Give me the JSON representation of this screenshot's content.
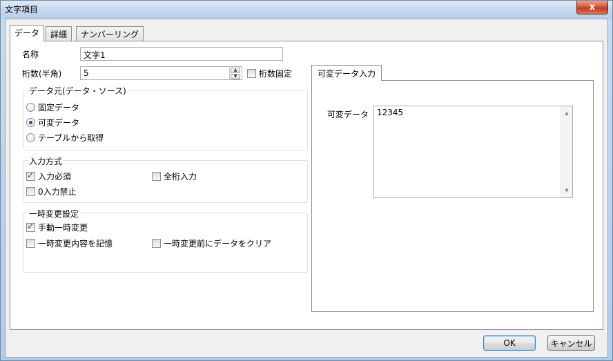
{
  "window": {
    "title": "文字項目",
    "close_label": "x"
  },
  "tabs": [
    {
      "label": "データ"
    },
    {
      "label": "詳細"
    },
    {
      "label": "ナンバーリング"
    }
  ],
  "form": {
    "name_label": "名称",
    "name_value": "文字1",
    "digits_label": "桁数(半角)",
    "digits_value": "5",
    "digits_fixed_label": "桁数固定",
    "digits_fixed_checked": false
  },
  "data_source": {
    "title": "データ元(データ・ソース)",
    "options": [
      {
        "label": "固定データ",
        "checked": false
      },
      {
        "label": "可変データ",
        "checked": true
      },
      {
        "label": "テーブルから取得",
        "checked": false
      }
    ]
  },
  "input_method": {
    "title": "入力方式",
    "required_label": "入力必須",
    "required_checked": true,
    "full_digits_label": "全桁入力",
    "full_digits_checked": false,
    "zero_forbidden_label": "0入力禁止",
    "zero_forbidden_checked": false
  },
  "temp_change": {
    "title": "一時変更設定",
    "manual_label": "手動一時変更",
    "manual_checked": true,
    "remember_label": "一時変更内容を記憶",
    "remember_checked": false,
    "clear_label": "一時変更前にデータをクリア",
    "clear_checked": false
  },
  "variable_panel": {
    "tab_label": "可変データ入力",
    "field_label": "可変データ",
    "value": "12345"
  },
  "buttons": {
    "ok_label": "OK",
    "cancel_label": "キャンセル"
  }
}
